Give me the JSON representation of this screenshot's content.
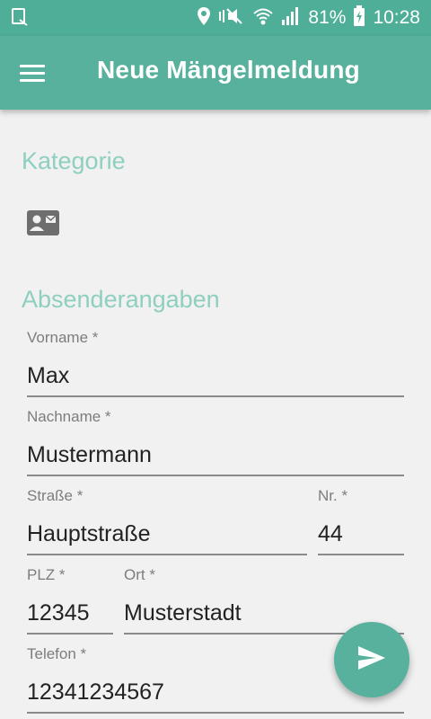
{
  "status_bar": {
    "battery": "81%",
    "time": "10:28",
    "icons": [
      "screenshot-icon",
      "location-icon",
      "vibrate-icon",
      "wifi-icon",
      "signal-icon",
      "battery-icon"
    ]
  },
  "app_bar": {
    "title": "Neue Mängelmeldung",
    "menu_icon": "menu-icon"
  },
  "sections": {
    "category_title": "Kategorie",
    "category_icon": "contact-card-icon",
    "sender_title": "Absenderangaben"
  },
  "form": {
    "first_name": {
      "label": "Vorname *",
      "value": "Max"
    },
    "last_name": {
      "label": "Nachname *",
      "value": "Mustermann"
    },
    "street": {
      "label": "Straße *",
      "value": "Hauptstraße"
    },
    "number": {
      "label": "Nr. *",
      "value": "44"
    },
    "zip": {
      "label": "PLZ *",
      "value": "12345"
    },
    "city": {
      "label": "Ort *",
      "value": "Musterstadt"
    },
    "phone": {
      "label": "Telefon *",
      "value": "12341234567"
    }
  },
  "fab": {
    "icon": "send-icon"
  },
  "colors": {
    "primary": "#58b19d",
    "status_bar": "#4fae98",
    "section_title": "#8fcfc0",
    "background": "#f1f1f1"
  }
}
